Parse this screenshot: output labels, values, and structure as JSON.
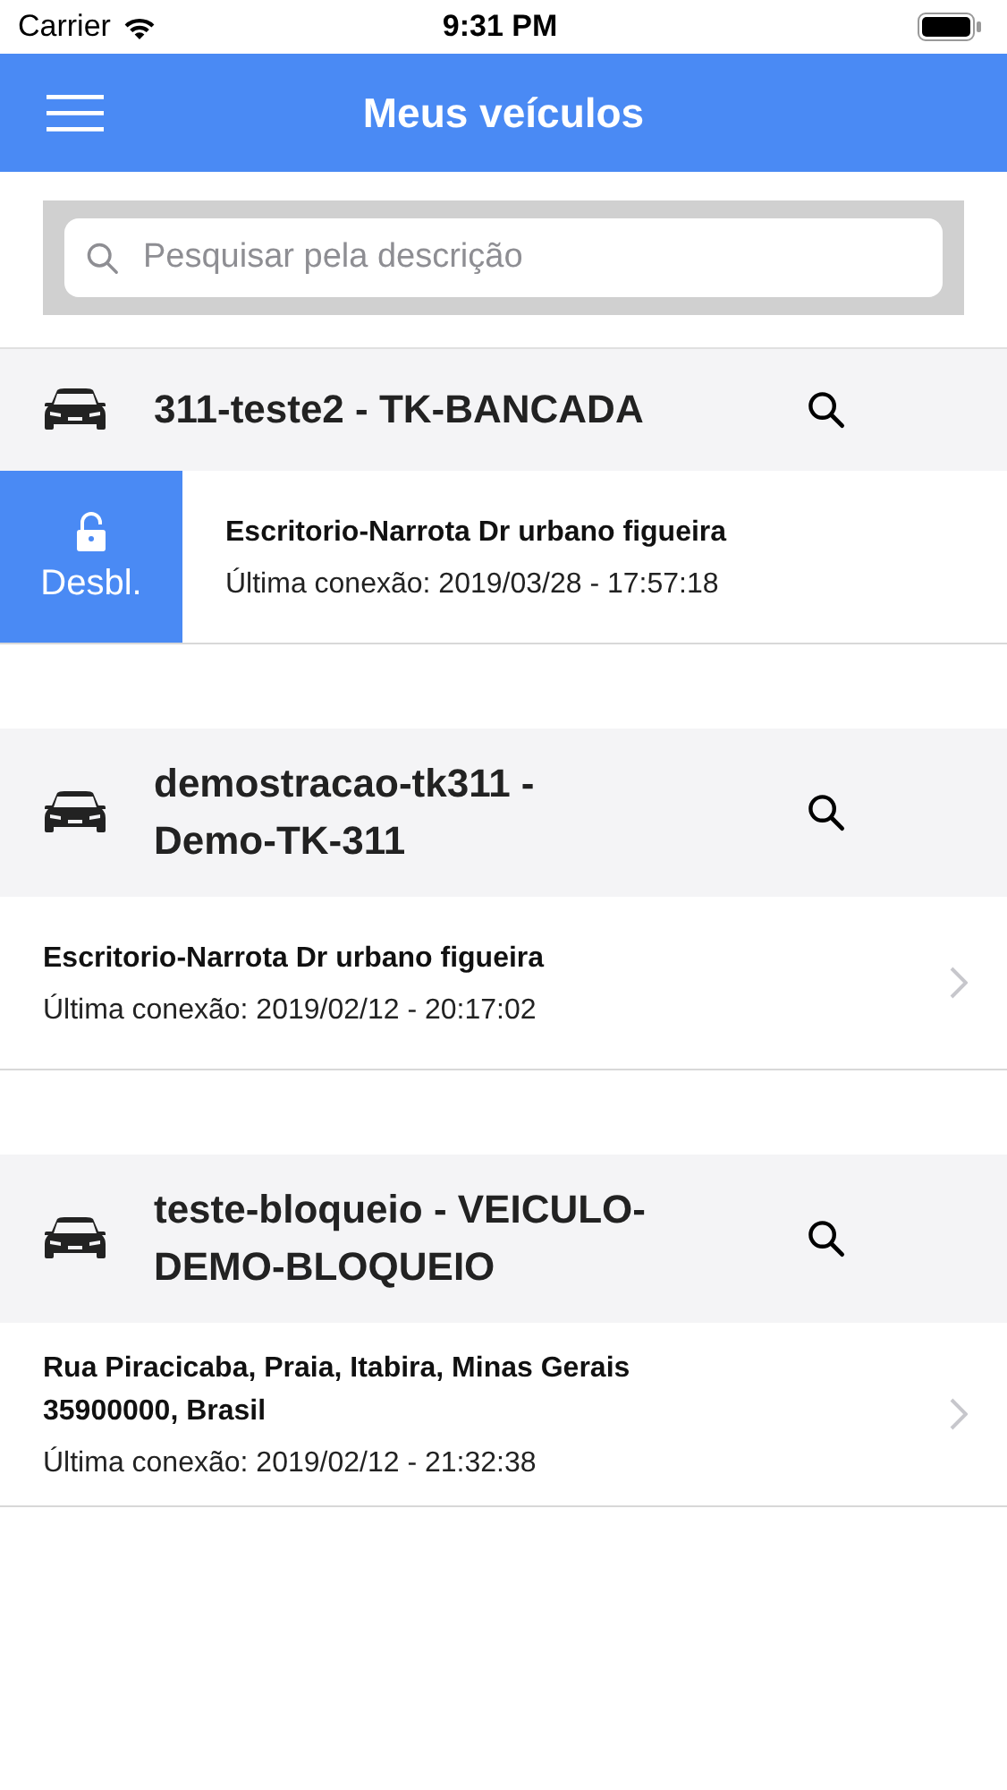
{
  "status_bar": {
    "carrier": "Carrier",
    "time": "9:31 PM"
  },
  "header": {
    "title": "Meus veículos"
  },
  "search": {
    "placeholder": "Pesquisar pela descrição"
  },
  "vehicles": [
    {
      "title": "311-teste2 - TK-BANCADA",
      "address": "Escritorio-Narrota Dr urbano figueira",
      "last_connection": "Última conexão: 2019/03/28 - 17:57:18",
      "action": {
        "label": "Desbl."
      }
    },
    {
      "title": "demostracao-tk311 - Demo-TK-311",
      "address": "Escritorio-Narrota Dr urbano figueira",
      "last_connection": "Última conexão: 2019/02/12 - 20:17:02"
    },
    {
      "title": "teste-bloqueio - VEICULO-DEMO-BLOQUEIO",
      "address": "Rua Piracicaba, Praia, Itabira, Minas Gerais 35900000, Brasil",
      "last_connection": "Última conexão: 2019/02/12 - 21:32:38"
    }
  ]
}
